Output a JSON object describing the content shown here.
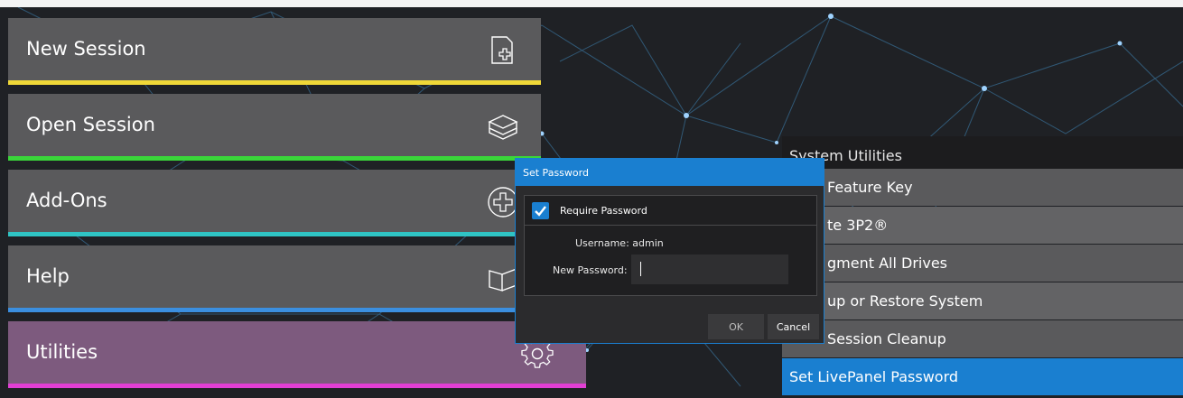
{
  "menu": {
    "items": [
      {
        "label": "New Session",
        "icon": "new-file-icon",
        "bar_color": "#f0d838"
      },
      {
        "label": "Open Session",
        "icon": "open-box-icon",
        "bar_color": "#3ad63a"
      },
      {
        "label": "Add-Ons",
        "icon": "add-circle-icon",
        "bar_color": "#2fc4c4"
      },
      {
        "label": "Help",
        "icon": "book-icon",
        "bar_color": "#3b8fe0"
      },
      {
        "label": "Utilities",
        "icon": "gear-icon",
        "bar_color": "#e23fd4"
      }
    ]
  },
  "system_utilities": {
    "header": "System Utilities",
    "items": [
      {
        "label": "Feature Key"
      },
      {
        "label": "te 3P2®"
      },
      {
        "label": "gment All Drives"
      },
      {
        "label": "up or Restore System"
      },
      {
        "label": "Session Cleanup"
      },
      {
        "label": "Set LivePanel Password",
        "selected": true
      }
    ]
  },
  "dialog": {
    "title": "Set Password",
    "require_password_label": "Require Password",
    "require_password_checked": true,
    "username_text": "Username: admin",
    "new_password_label": "New Password:",
    "new_password_value": "",
    "ok_label": "OK",
    "cancel_label": "Cancel"
  },
  "colors": {
    "accent": "#1a7fd0",
    "menu_bg": "#5a5a5c",
    "utilities_bg": "#7d5a7e",
    "stage_bg": "#1f2125"
  }
}
